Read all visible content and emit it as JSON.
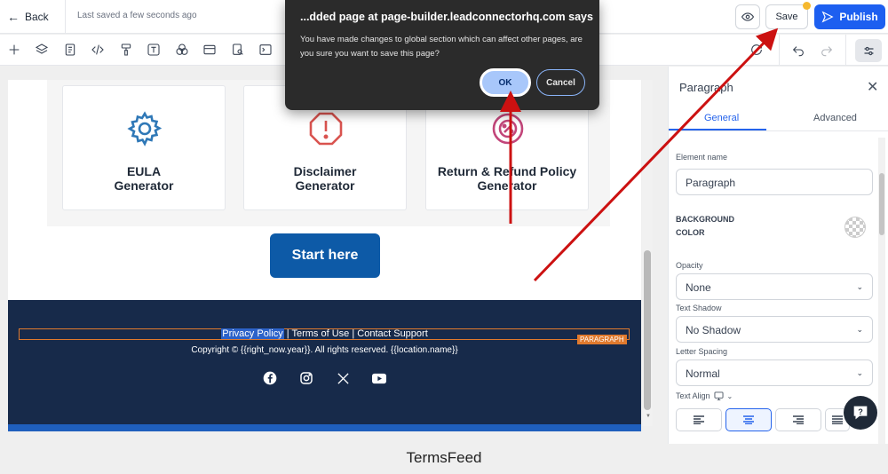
{
  "topbar": {
    "back_label": "Back",
    "saved_status": "Last saved a few seconds ago",
    "save_label": "Save",
    "publish_label": "Publish"
  },
  "dialog": {
    "title": "...dded page at page-builder.leadconnectorhq.com says",
    "message": "You have made changes to global section which can affect other pages, are you sure you want to save this page?",
    "ok_label": "OK",
    "cancel_label": "Cancel"
  },
  "canvas": {
    "cards": [
      {
        "title": "EULA Generator",
        "icon": "gear-icon",
        "color": "#2f78b7"
      },
      {
        "title": "Disclaimer Generator",
        "icon": "alert-octagon-icon",
        "color": "#d9534f"
      },
      {
        "title": "Return & Refund Policy Generator",
        "icon": "refund-icon",
        "color": "#c2467a"
      }
    ],
    "start_button": "Start here",
    "footer": {
      "link_privacy": "Privacy Policy",
      "separator": " | ",
      "link_terms": "Terms of Use",
      "link_support": "Contact Support",
      "paragraph_tag": "PARAGRAPH",
      "copyright": "Copyright © {{right_now.year}}. All rights reserved. {{location.name}}",
      "socials": [
        "facebook-icon",
        "instagram-icon",
        "x-icon",
        "youtube-icon"
      ]
    }
  },
  "panel": {
    "title": "Paragraph",
    "tabs": [
      "General",
      "Advanced"
    ],
    "element_name_label": "Element name",
    "element_name_value": "Paragraph",
    "bg_color_label_1": "BACKGROUND",
    "bg_color_label_2": "COLOR",
    "opacity_label": "Opacity",
    "opacity_value": "None",
    "text_shadow_label": "Text Shadow",
    "text_shadow_value": "No Shadow",
    "letter_spacing_label": "Letter Spacing",
    "letter_spacing_value": "Normal",
    "text_align_label": "Text Align"
  },
  "watermark": "TermsFeed",
  "colors": {
    "publish": "#1d5ff0",
    "footer_bg": "#172a4a",
    "start_button": "#0d5aa7",
    "annotation_arrow": "#cc1111",
    "selection_outline": "#e07a2e"
  }
}
